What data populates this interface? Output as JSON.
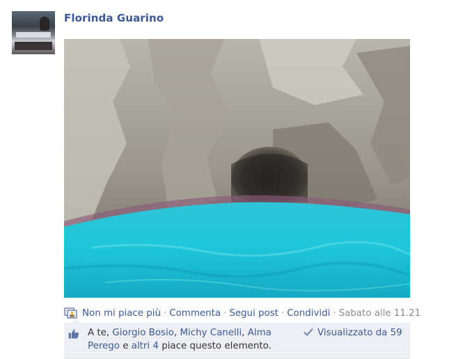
{
  "post": {
    "author": "Florinda Guarino",
    "photo_alt": "Grotta con acqua turchese"
  },
  "actions": {
    "unlike": "Non mi piace più",
    "comment": "Commenta",
    "follow": "Segui post",
    "share": "Condividi",
    "separator": "·",
    "timestamp": "Sabato alle 11.21"
  },
  "likes": {
    "prefix": "A te, ",
    "names": [
      "Giorgio Bosio",
      "Michy Canelli",
      "Alma Perego"
    ],
    "comma": ", ",
    "and": " e ",
    "others": "altri 4",
    "suffix": " piace questo elemento.",
    "seen_by": "Visualizzato da 59"
  },
  "colors": {
    "link": "#3b5998",
    "like_box_bg": "#edeff4",
    "meta": "#7f7f7f"
  }
}
